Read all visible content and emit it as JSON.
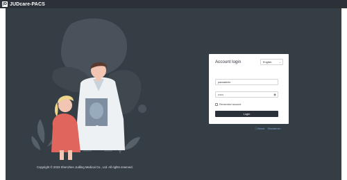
{
  "titlebar": {
    "logo": "JD",
    "title": "JUDcare-PACS"
  },
  "login": {
    "title": "Account login",
    "language": "English",
    "username_value": "pacsadmin",
    "password_value": "••••••",
    "remember_label": "Remember account",
    "remember_checked": false,
    "login_button": "Login"
  },
  "links": {
    "about": "ⓘAbout",
    "disclaimer": "Disclaimer"
  },
  "footer": {
    "copyright": "Copyright © 2023 Shenzhen Judling Medical Co., Ltd. All rights reserved."
  },
  "colors": {
    "titlebar": "#2b3137",
    "background": "#353d45",
    "button": "#2a3138",
    "link": "#7eaedb",
    "accent_red": "#e0665d"
  },
  "icons": {
    "logo": "jd-logo-icon",
    "dropdown": "chevron-down-icon",
    "eye": "eye-icon",
    "about": "info-icon"
  }
}
